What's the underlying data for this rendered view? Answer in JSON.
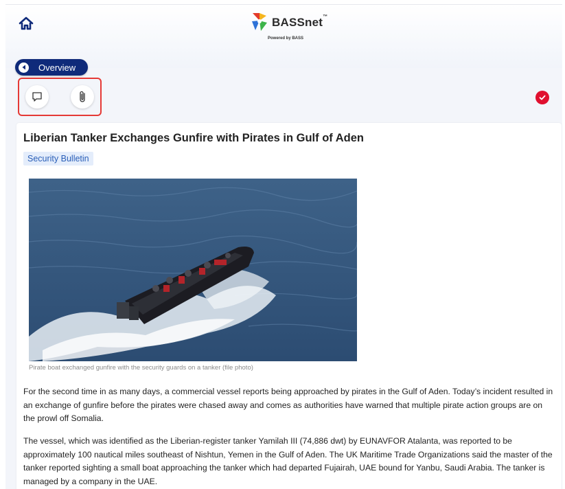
{
  "brand": {
    "name": "BASSnet",
    "trademark": "™",
    "powered_by": "Powered by BASS"
  },
  "nav": {
    "overview_label": "Overview"
  },
  "icons": {
    "home": "home-icon",
    "back": "chevron-left-icon",
    "comment": "comment-icon",
    "attachment": "paperclip-icon",
    "status": "check-circle-icon"
  },
  "colors": {
    "accent_navy": "#0f2a7a",
    "highlight_red": "#e53935",
    "status_red": "#e0102f",
    "tag_bg": "#e4edfb",
    "tag_text": "#2a5fb8"
  },
  "article": {
    "title": "Liberian Tanker Exchanges Gunfire with Pirates in Gulf of Aden",
    "tag": "Security Bulletin",
    "image_caption": "Pirate boat exchanged gunfire with the security guards on a tanker (file photo)",
    "paragraphs": [
      "For the second time in as many days, a commercial vessel reports being approached by pirates in the Gulf of Aden. Today’s incident resulted in an exchange of gunfire before the pirates were chased away and comes as authorities have warned that multiple pirate action groups are on the prowl off Somalia.",
      "The vessel, which was identified as the Liberian-register tanker Yamilah III (74,886 dwt) by EUNAVFOR Atalanta, was reported to be approximately 100 nautical miles southeast of Nishtun, Yemen in the Gulf of Aden. The UK Maritime Trade Organizations said the master of the tanker reported sighting a small boat approaching the tanker which had departed Fujairah, UAE bound for Yanbu, Saudi Arabia. The tanker is managed by a company in the UAE."
    ]
  }
}
